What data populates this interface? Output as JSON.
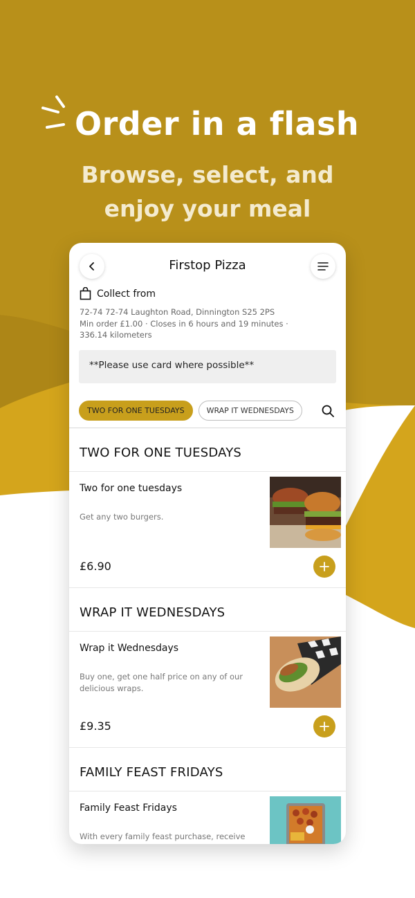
{
  "hero": {
    "title": "Order in a flash",
    "subtitle_line1": "Browse, select, and",
    "subtitle_line2": "enjoy your meal"
  },
  "colors": {
    "gold": "#c89f1c",
    "olive_bg": "#b8901a",
    "bright_gold": "#d4a51c"
  },
  "restaurant": {
    "name": "Firstop Pizza",
    "collect_label": "Collect from",
    "address_line": "72-74  72-74 Laughton Road, Dinnington  S25 2PS",
    "info_line": "Min order £1.00 · Closes in 6 hours and 19 minutes · 336.14 kilometers",
    "notice": "**Please use card where possible**"
  },
  "tabs": [
    {
      "label": "TWO FOR ONE TUESDAYS",
      "active": true
    },
    {
      "label": "WRAP IT WEDNESDAYS",
      "active": false
    }
  ],
  "sections": [
    {
      "title": "TWO FOR ONE TUESDAYS",
      "item": {
        "name": "Two for one tuesdays",
        "description": "Get any two burgers.",
        "price": "£6.90",
        "image": "burger-image"
      }
    },
    {
      "title": "WRAP IT WEDNESDAYS",
      "item": {
        "name": "Wrap it Wednesdays",
        "description": "Buy one, get one half price on any of our delicious wraps.",
        "price": "£9.35",
        "image": "wrap-image"
      }
    },
    {
      "title": "FAMILY FEAST FRIDAYS",
      "item": {
        "name": "Family Feast Fridays",
        "description": "With every family feast purchase, receive two",
        "image": "family-feast-image"
      }
    }
  ],
  "icons": [
    "back-arrow-icon",
    "menu-icon",
    "shopping-bag-icon",
    "search-icon",
    "plus-icon",
    "sparkle-icon"
  ]
}
